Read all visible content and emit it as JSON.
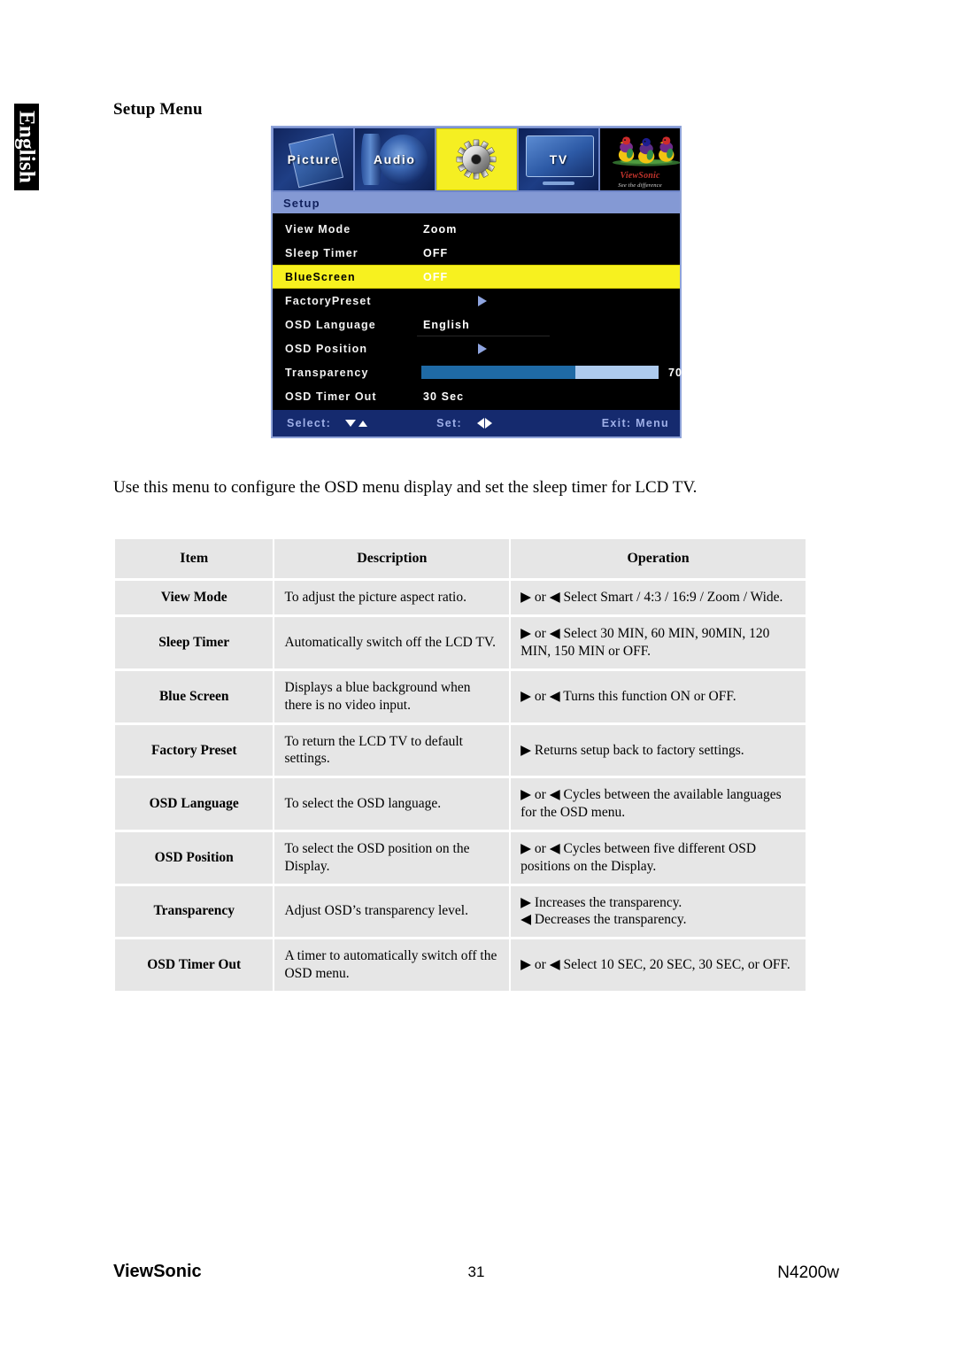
{
  "sidebar_tab": {
    "label": "English"
  },
  "page_title": "Setup Menu",
  "osd": {
    "tabs": [
      {
        "label": "Picture",
        "icon": "picture-icon",
        "selected": false
      },
      {
        "label": "Audio",
        "icon": "speaker-icon",
        "selected": false
      },
      {
        "label": "",
        "icon": "gear-icon",
        "selected": true
      },
      {
        "label": "TV",
        "icon": "tv-icon",
        "selected": false
      },
      {
        "label": "",
        "icon": "viewsonic-birds-logo",
        "selected": false
      }
    ],
    "logo": {
      "name": "ViewSonic",
      "tagline": "See the difference"
    },
    "header": "Setup",
    "rows": [
      {
        "label": "View Mode",
        "value": "Zoom",
        "type": "value",
        "selected": false
      },
      {
        "label": "Sleep Timer",
        "value": "OFF",
        "type": "value",
        "selected": false
      },
      {
        "label": "BlueScreen",
        "value": "OFF",
        "type": "value",
        "selected": true
      },
      {
        "label": "FactoryPreset",
        "value": "",
        "type": "arrow",
        "selected": false
      },
      {
        "label": "OSD Language",
        "value": "English",
        "type": "value",
        "selected": false
      },
      {
        "label": "OSD Position",
        "value": "",
        "type": "arrow",
        "selected": false
      },
      {
        "label": "Transparency",
        "value": "70",
        "type": "slider",
        "selected": false,
        "percent": 65
      },
      {
        "label": "OSD Timer Out",
        "value": "30 Sec",
        "type": "value",
        "selected": false
      }
    ],
    "status": {
      "select_label": "Select:",
      "set_label": "Set:",
      "exit_label": "Exit: Menu"
    },
    "colors": {
      "highlight": "#f7f11f",
      "header_bar": "#8499d4",
      "status_bar": "#152a6e",
      "slider_fill": "#1f6aa5",
      "slider_track": "#aecbee",
      "arrow": "#8fa5e0"
    }
  },
  "intro": "Use this menu to configure the OSD menu display and set the sleep timer for LCD TV.",
  "table": {
    "headers": [
      "Item",
      "Description",
      "Operation"
    ],
    "rows": [
      {
        "item": "View Mode",
        "description": "To adjust the picture aspect ratio.",
        "operation": [
          "▶ or ◀ Select Smart / 4:3 / 16:9 / Zoom / Wide."
        ]
      },
      {
        "item": "Sleep Timer",
        "description": "Automatically switch off the LCD TV.",
        "operation": [
          "▶ or ◀ Select 30 MIN, 60 MIN, 90MIN, 120 MIN, 150 MIN or OFF."
        ]
      },
      {
        "item": "Blue Screen",
        "description": "Displays a blue background when there is no video input.",
        "operation": [
          "▶ or ◀ Turns this function ON or OFF."
        ]
      },
      {
        "item": "Factory Preset",
        "description": "To return the LCD TV to default settings.",
        "operation": [
          "▶ Returns setup back to factory settings."
        ]
      },
      {
        "item": "OSD Language",
        "description": "To select the OSD language.",
        "operation": [
          "▶ or ◀ Cycles between the available languages for the OSD menu."
        ]
      },
      {
        "item": "OSD Position",
        "description": "To select the OSD position on the Display.",
        "operation": [
          "▶ or ◀ Cycles between five different OSD positions on the Display."
        ]
      },
      {
        "item": "Transparency",
        "description": "Adjust OSD’s transparency level.",
        "operation": [
          "▶  Increases the transparency.",
          "◀ Decreases the transparency."
        ]
      },
      {
        "item": "OSD Timer Out",
        "description": "A timer to automatically switch off the OSD menu.",
        "operation": [
          "▶ or ◀  Select 10 SEC, 20 SEC, 30 SEC, or OFF."
        ]
      }
    ]
  },
  "footer": {
    "brand": "ViewSonic",
    "page_number": "31",
    "model": "N4200w"
  }
}
